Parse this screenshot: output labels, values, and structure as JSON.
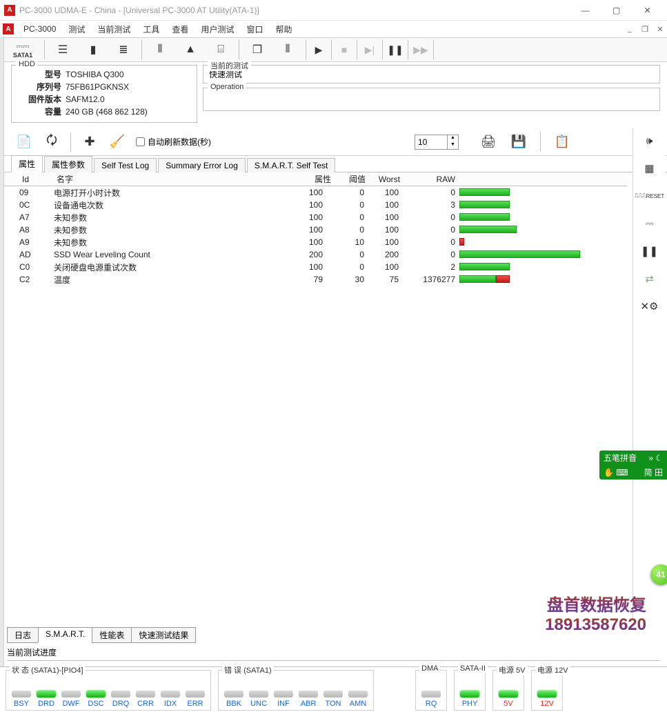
{
  "window": {
    "title": "PC-3000 UDMA-E - China - [Universal PC-3000 AT Utility(ATA-1)]"
  },
  "menubar": {
    "app": "PC-3000",
    "items": [
      "测试",
      "当前测试",
      "工具",
      "查看",
      "用户测试",
      "窗口",
      "帮助"
    ]
  },
  "toolbar": {
    "sata_label": "SATA1"
  },
  "hdd": {
    "legend": "HDD",
    "model_lbl": "型号",
    "model": "TOSHIBA Q300",
    "serial_lbl": "序列号",
    "serial": "75FB61PGKNSX",
    "fw_lbl": "固件版本",
    "fw": "SAFM12.0",
    "cap_lbl": "容量",
    "cap": "240 GB (468 862 128)"
  },
  "right_boxes": {
    "current_test_legend": "当前的测试",
    "current_test_value": "快速测试",
    "operation_legend": "Operation"
  },
  "toolbar2": {
    "auto_refresh": "自动刷新数据(秒)",
    "interval": "10"
  },
  "inner_tabs": [
    "属性",
    "属性参数",
    "Self Test Log",
    "Summary Error Log",
    "S.M.A.R.T. Self Test"
  ],
  "columns": {
    "id": "Id",
    "name": "名字",
    "attr": "属性",
    "thr": "阈值",
    "worst": "Worst",
    "raw": "RAW"
  },
  "rows": [
    {
      "id": "09",
      "name": "电源打开小时计数",
      "attr": 100,
      "thr": 0,
      "worst": 100,
      "raw": 0,
      "g": 30,
      "r": 0
    },
    {
      "id": "0C",
      "name": "设备通电次数",
      "attr": 100,
      "thr": 0,
      "worst": 100,
      "raw": 3,
      "g": 30,
      "r": 0
    },
    {
      "id": "A7",
      "name": "未知参数",
      "attr": 100,
      "thr": 0,
      "worst": 100,
      "raw": 0,
      "g": 30,
      "r": 0
    },
    {
      "id": "A8",
      "name": "未知参数",
      "attr": 100,
      "thr": 0,
      "worst": 100,
      "raw": 0,
      "g": 34,
      "r": 0
    },
    {
      "id": "A9",
      "name": "未知参数",
      "attr": 100,
      "thr": 10,
      "worst": 100,
      "raw": 0,
      "g": 0,
      "r": 3
    },
    {
      "id": "AD",
      "name": "SSD Wear Leveling Count",
      "attr": 200,
      "thr": 0,
      "worst": 200,
      "raw": 0,
      "g": 72,
      "r": 0
    },
    {
      "id": "C0",
      "name": "关闭硬盘电源重试次数",
      "attr": 100,
      "thr": 0,
      "worst": 100,
      "raw": 2,
      "g": 30,
      "r": 0
    },
    {
      "id": "C2",
      "name": "温度",
      "attr": 79,
      "thr": 30,
      "worst": 75,
      "raw": 1376277,
      "g": 22,
      "r": 8
    }
  ],
  "sidebar": {
    "reset": "RESET"
  },
  "bottom_tabs": [
    "日志",
    "S.M.A.R.T.",
    "性能表",
    "快速测试结果"
  ],
  "progress_label": "当前测试进度",
  "status": {
    "group1": {
      "legend": "状 态 (SATA1)-[PIO4]",
      "items": [
        {
          "l": "BSY",
          "led": "off"
        },
        {
          "l": "DRD",
          "led": "green"
        },
        {
          "l": "DWF",
          "led": "off"
        },
        {
          "l": "DSC",
          "led": "green"
        },
        {
          "l": "DRQ",
          "led": "off"
        },
        {
          "l": "CRR",
          "led": "off"
        },
        {
          "l": "IDX",
          "led": "off"
        },
        {
          "l": "ERR",
          "led": "off"
        }
      ]
    },
    "group2": {
      "legend": "错 误 (SATA1)",
      "items": [
        {
          "l": "BBK",
          "led": "off"
        },
        {
          "l": "UNC",
          "led": "off"
        },
        {
          "l": "INF",
          "led": "off"
        },
        {
          "l": "ABR",
          "led": "off"
        },
        {
          "l": "TON",
          "led": "off"
        },
        {
          "l": "AMN",
          "led": "off"
        }
      ]
    },
    "group3": {
      "legend": "DMA",
      "items": [
        {
          "l": "RQ",
          "led": "off"
        }
      ]
    },
    "group4": {
      "legend": "SATA-II",
      "items": [
        {
          "l": "PHY",
          "led": "green"
        }
      ]
    },
    "group5": {
      "legend": "电源 5V",
      "items": [
        {
          "l": "5V",
          "led": "green",
          "cls": "red"
        }
      ]
    },
    "group6": {
      "legend": "电源 12V",
      "items": [
        {
          "l": "12V",
          "led": "green",
          "cls": "red"
        }
      ]
    }
  },
  "watermark": {
    "line1": "盘首数据恢复",
    "line2": "18913587620"
  },
  "ime": {
    "line1": "五笔拼音",
    "line2": "简 ⽥"
  },
  "badge": "41"
}
